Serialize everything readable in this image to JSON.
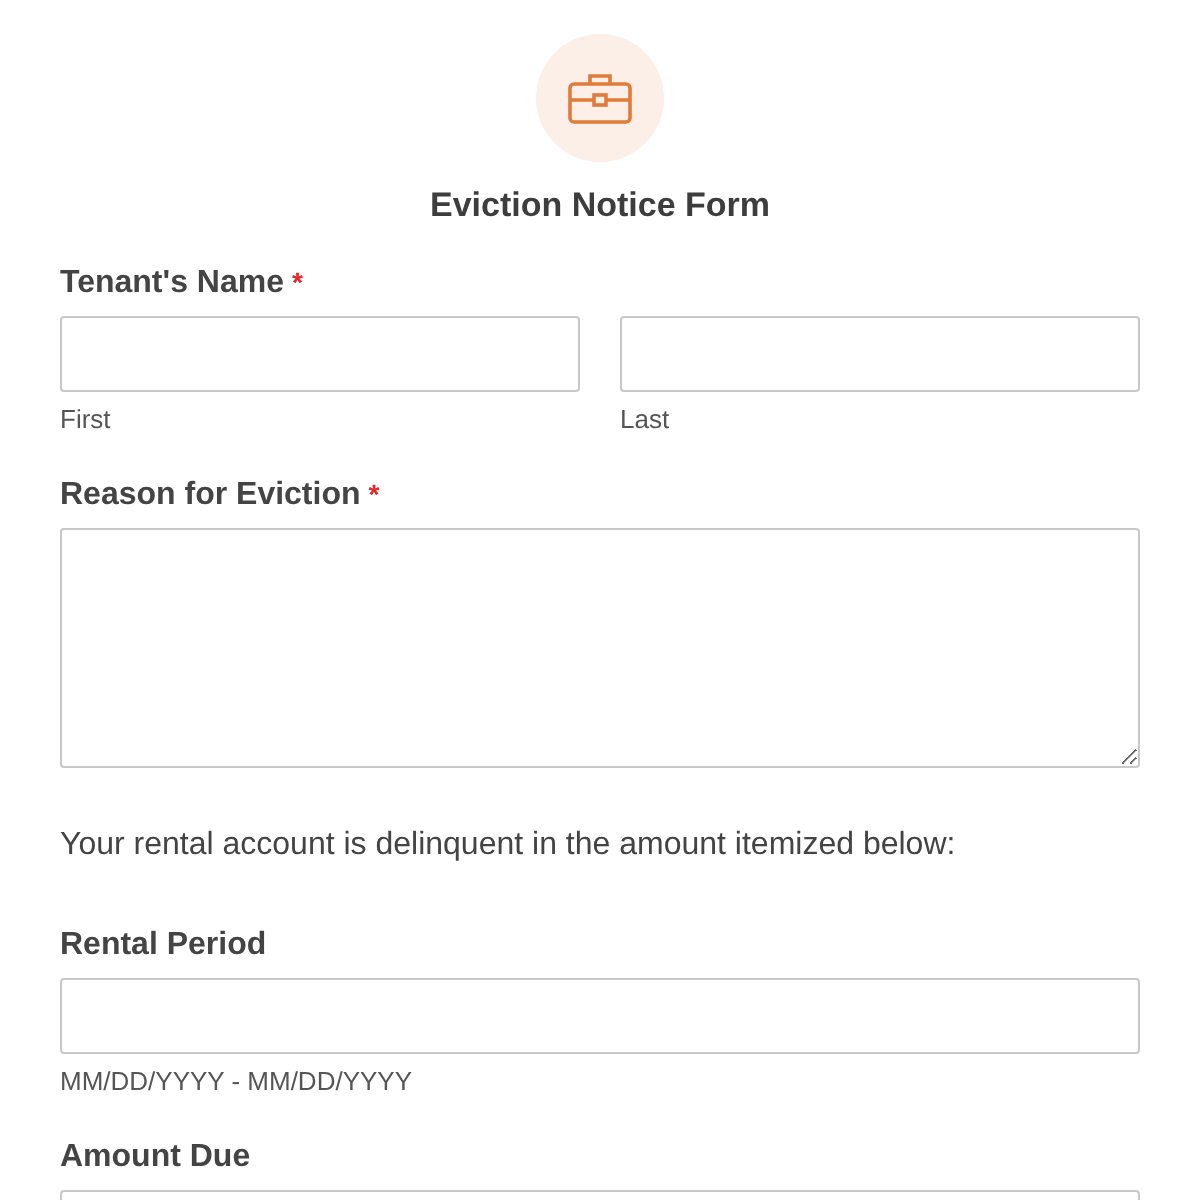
{
  "form": {
    "title": "Eviction Notice Form"
  },
  "fields": [
    {
      "kind": "name",
      "label": "Tenant's Name",
      "required_mark": "*",
      "sublabels": [
        "First",
        "Last"
      ]
    },
    {
      "kind": "textarea",
      "label": "Reason for Eviction",
      "required_mark": "*"
    },
    {
      "kind": "text",
      "text": "Your rental account is delinquent in the amount itemized below:"
    },
    {
      "kind": "input",
      "label": "Rental Period",
      "hint": "MM/DD/YYYY - MM/DD/YYYY"
    },
    {
      "kind": "input",
      "label": "Amount Due"
    }
  ]
}
